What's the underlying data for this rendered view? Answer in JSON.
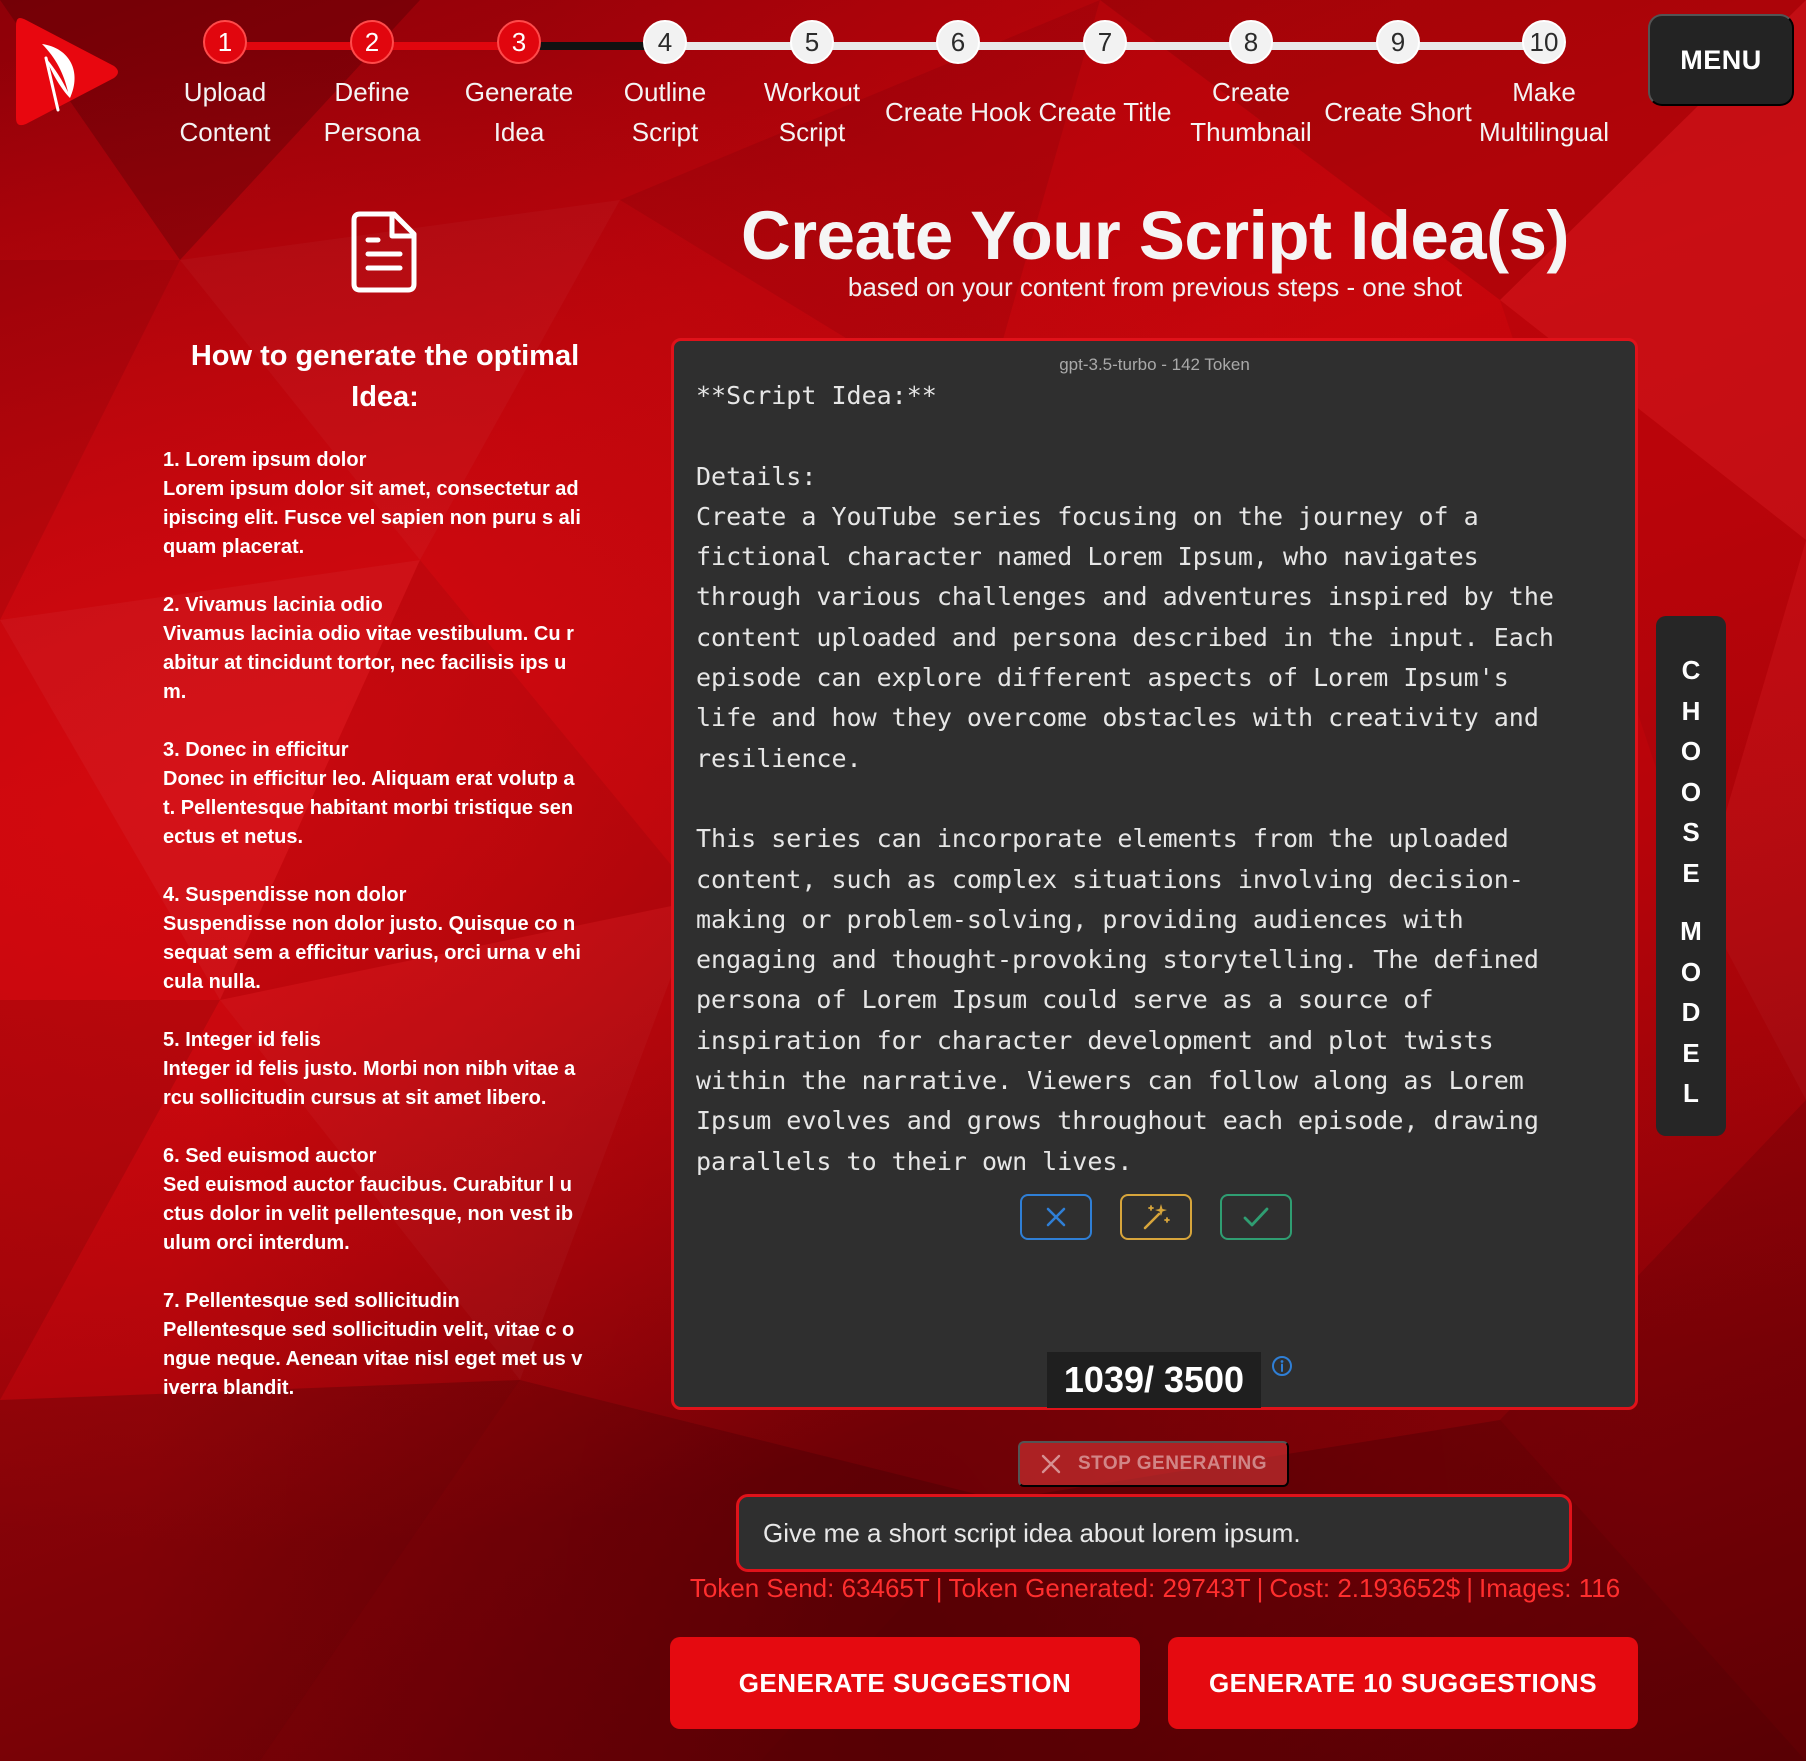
{
  "stepper": {
    "steps": [
      {
        "num": "1",
        "label": "Upload Content"
      },
      {
        "num": "2",
        "label": "Define Persona"
      },
      {
        "num": "3",
        "label": "Generate Idea"
      },
      {
        "num": "4",
        "label": "Outline Script"
      },
      {
        "num": "5",
        "label": "Workout Script"
      },
      {
        "num": "6",
        "label": "Create Hook"
      },
      {
        "num": "7",
        "label": "Create Title"
      },
      {
        "num": "8",
        "label": "Create Thumbnail"
      },
      {
        "num": "9",
        "label": "Create Short"
      },
      {
        "num": "10",
        "label": "Make Multilingual"
      }
    ],
    "current_step": 3
  },
  "header": {
    "menu_label": "MENU"
  },
  "sidebar": {
    "title": "How to generate the optimal Idea:",
    "tips": [
      {
        "title": "1. Lorem ipsum dolor",
        "body": "Lorem ipsum dolor sit amet, consectetur adipiscing elit. Fusce vel sapien non puru s aliquam placerat."
      },
      {
        "title": "2. Vivamus lacinia odio",
        "body": "Vivamus lacinia odio vitae vestibulum. Cu rabitur at tincidunt tortor, nec facilisis ips um."
      },
      {
        "title": "3. Donec in efficitur",
        "body": "Donec in efficitur leo. Aliquam erat volutp at. Pellentesque habitant morbi tristique senectus et netus."
      },
      {
        "title": "4. Suspendisse non dolor",
        "body": "Suspendisse non dolor justo. Quisque co nsequat sem a efficitur varius, orci urna v ehicula nulla."
      },
      {
        "title": "5. Integer id felis",
        "body": "Integer id felis justo. Morbi non nibh vitae arcu sollicitudin cursus at sit amet libero."
      },
      {
        "title": "6. Sed euismod auctor",
        "body": "Sed euismod auctor faucibus. Curabitur l uctus dolor in velit pellentesque, non vest ibulum orci interdum."
      },
      {
        "title": "7. Pellentesque sed sollicitudin",
        "body": "Pellentesque sed sollicitudin velit, vitae c ongue neque. Aenean vitae nisl eget met us viverra blandit."
      }
    ]
  },
  "main": {
    "title": "Create Your Script Idea(s)",
    "subtitle": "based on your content from previous steps - one shot",
    "model_tag": "gpt-3.5-turbo - 142 Token",
    "output_text": "**Script Idea:**\n\nDetails:\nCreate a YouTube series focusing on the journey of a\nfictional character named Lorem Ipsum, who navigates\nthrough various challenges and adventures inspired by the\ncontent uploaded and persona described in the input. Each\nepisode can explore different aspects of Lorem Ipsum's\nlife and how they overcome obstacles with creativity and\nresilience.\n\nThis series can incorporate elements from the uploaded\ncontent, such as complex situations involving decision-\nmaking or problem-solving, providing audiences with\nengaging and thought-provoking storytelling. The defined\npersona of Lorem Ipsum could serve as a source of\ninspiration for character development and plot twists\nwithin the narrative. Viewers can follow along as Lorem\nIpsum evolves and grows throughout each episode, drawing\nparallels to their own lives.",
    "counter": "1039/ 3500",
    "action_icons": [
      "close-icon",
      "magic-wand-icon",
      "check-icon"
    ]
  },
  "model_tab": {
    "letters": [
      "C",
      "H",
      "O",
      "O",
      "S",
      "E",
      "",
      "M",
      "O",
      "D",
      "E",
      "L"
    ]
  },
  "controls": {
    "stop_label": "STOP GENERATING",
    "prompt_value": "Give me a short script idea about lorem ipsum.",
    "stats": {
      "token_send": "Token Send: 63465T",
      "token_generated": "Token  Generated: 29743T",
      "cost": "Cost: 2.193652$",
      "images": "Images: 116"
    },
    "generate_one_label": "GENERATE SUGGESTION",
    "generate_ten_label": "GENERATE 10 SUGGESTIONS"
  },
  "colors": {
    "accent": "#e50a10",
    "panel_bg": "#2f2f2f",
    "stats_text": "#ff2e2e",
    "cancel_blue": "#2f7fd6",
    "magic_gold": "#d7a53b",
    "accept_green": "#2f9e72"
  }
}
